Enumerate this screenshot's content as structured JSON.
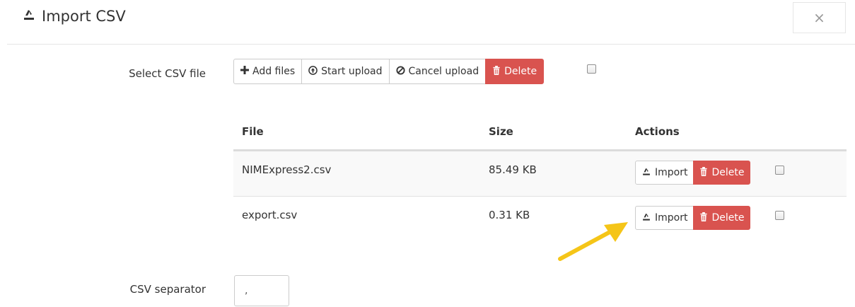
{
  "header": {
    "title": "Import CSV",
    "close_label": "×"
  },
  "upload": {
    "label": "Select CSV file",
    "buttons": {
      "add_files": "Add files",
      "start_upload": "Start upload",
      "cancel_upload": "Cancel upload",
      "delete": "Delete"
    }
  },
  "table": {
    "columns": [
      "File",
      "Size",
      "Actions"
    ],
    "rows": [
      {
        "file": "NIMExpress2.csv",
        "size": "85.49 KB",
        "import_label": "Import",
        "delete_label": "Delete"
      },
      {
        "file": "export.csv",
        "size": "0.31 KB",
        "import_label": "Import",
        "delete_label": "Delete"
      }
    ]
  },
  "separator": {
    "label": "CSV separator",
    "value": ","
  },
  "colors": {
    "danger": "#d9534f",
    "annotation_arrow": "#f5c518"
  },
  "icons": [
    "import-icon",
    "plus-icon",
    "upload-circle-icon",
    "ban-icon",
    "trash-icon",
    "close-icon"
  ]
}
